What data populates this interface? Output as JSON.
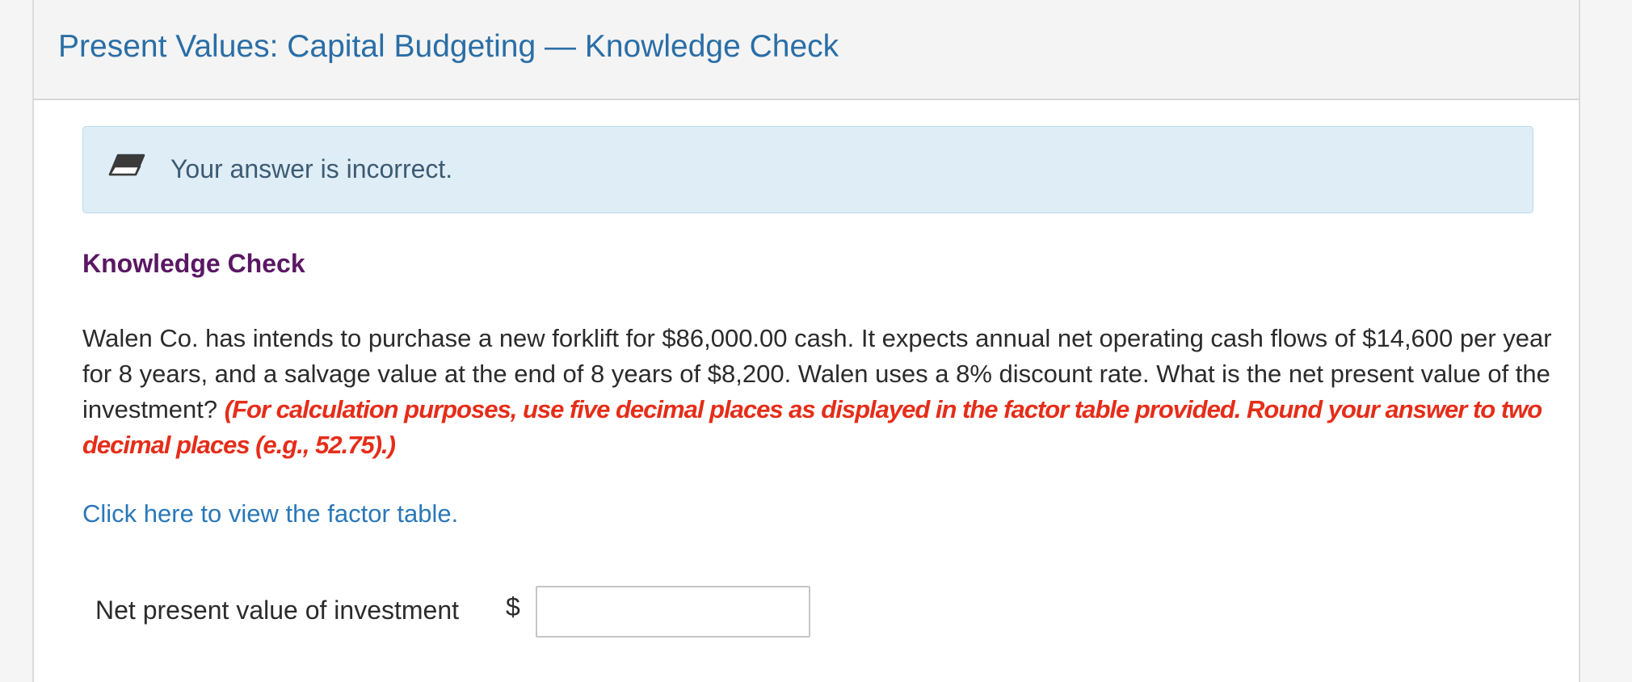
{
  "header": {
    "title": "Present Values: Capital Budgeting — Knowledge Check"
  },
  "feedback": {
    "message": "Your answer is incorrect.",
    "icon": "eraser-icon",
    "background_color": "#dfedf7"
  },
  "question": {
    "heading": "Knowledge Check",
    "body": "Walen Co. has intends to purchase a new forklift for $86,000.00 cash. It expects annual net operating cash flows of $14,600 per year for 8 years, and a salvage value at the end of 8 years of $8,200. Walen uses a 8% discount rate. What is the net present value of the investment?",
    "instruction": "(For calculation purposes, use five decimal places as displayed in the factor table provided. Round your answer to two decimal places (e.g., 52.75).)",
    "factor_table_link": "Click here to view the factor table."
  },
  "answer": {
    "label": "Net present value of investment",
    "currency_symbol": "$",
    "value": ""
  },
  "colors": {
    "title": "#2a6ea6",
    "heading": "#5a1763",
    "instruction": "#e52d19",
    "link": "#2a78b8"
  }
}
